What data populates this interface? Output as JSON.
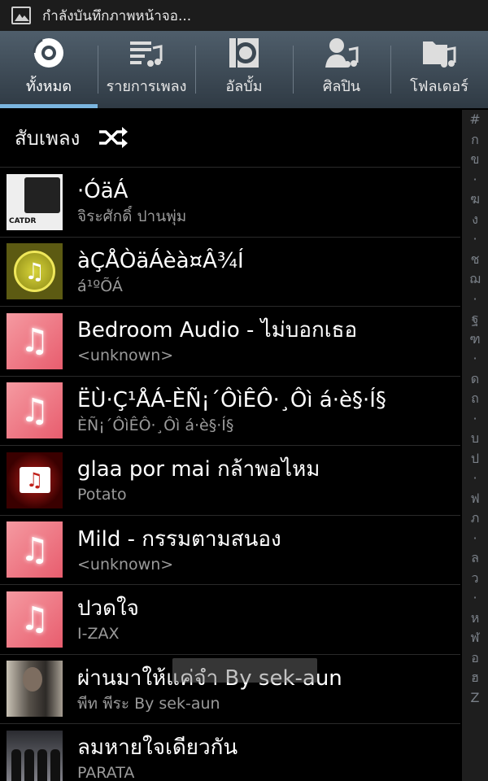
{
  "status_bar": {
    "text": "กำลังบันทึกภาพหน้าจอ...",
    "icon": "screenshot-icon"
  },
  "tabs": [
    {
      "label": "ทั้งหมด",
      "icon": "all-songs-icon",
      "active": true
    },
    {
      "label": "รายการเพลง",
      "icon": "playlist-icon",
      "active": false
    },
    {
      "label": "อัลบั้ม",
      "icon": "album-icon",
      "active": false
    },
    {
      "label": "ศิลปิน",
      "icon": "artist-icon",
      "active": false
    },
    {
      "label": "โฟลเดอร์",
      "icon": "folder-icon",
      "active": false
    }
  ],
  "shuffle": {
    "label": "สับเพลง",
    "icon": "shuffle-icon"
  },
  "songs": [
    {
      "title": "·ÓäÁ",
      "artist": "จิระศักดิ์ ปานพุ่ม",
      "art": "cover-photo"
    },
    {
      "title": "àÇÅÒäÁèà¤Â¾Í",
      "artist": "á¹ºÕÁ",
      "art": "gold-note"
    },
    {
      "title": "Bedroom Audio - ไม่บอกเธอ",
      "artist": "<unknown>",
      "art": "default-music"
    },
    {
      "title": "ËÙ·Ç¹ÅÁ-ÈÑ¡´ÔìÊÔ·¸Ôì á·è§·Í§",
      "artist": "ÈÑ¡´ÔìÊÔ·¸Ôì á·è§·Í§",
      "art": "default-music"
    },
    {
      "title": "glaa por mai กล้าพอไหม",
      "artist": "Potato",
      "art": "clapper"
    },
    {
      "title": "Mild - กรรมตามสนอง",
      "artist": "<unknown>",
      "art": "default-music"
    },
    {
      "title": "ปวดใจ",
      "artist": "I-ZAX",
      "art": "default-music"
    },
    {
      "title": "ผ่านมาให้แค่จำ By sek-aun",
      "artist": "พีท พีระ By sek-aun",
      "art": "artist-photo"
    },
    {
      "title": "ลมหายใจเดียวกัน",
      "artist": "PARATA",
      "art": "band-photo"
    }
  ],
  "album_art_text": "CATDR",
  "index_letters": [
    "#",
    "ก",
    "ข",
    "·",
    "ฆ",
    "ง",
    "·",
    "ช",
    "ฌ",
    "·",
    "ฐ",
    "ฑ",
    "·",
    "ด",
    "ถ",
    "·",
    "บ",
    "ป",
    "·",
    "ฟ",
    "ภ",
    "·",
    "ล",
    "ว",
    "·",
    "ห",
    "ฬ",
    "อ",
    "ฮ",
    "Z"
  ],
  "colors": {
    "tab_bg_top": "#4f5e6b",
    "tab_bg_bottom": "#2f3a44",
    "tab_active_indicator": "#7bb6e0",
    "background": "#000000",
    "artist_text": "#9a9a9a"
  }
}
